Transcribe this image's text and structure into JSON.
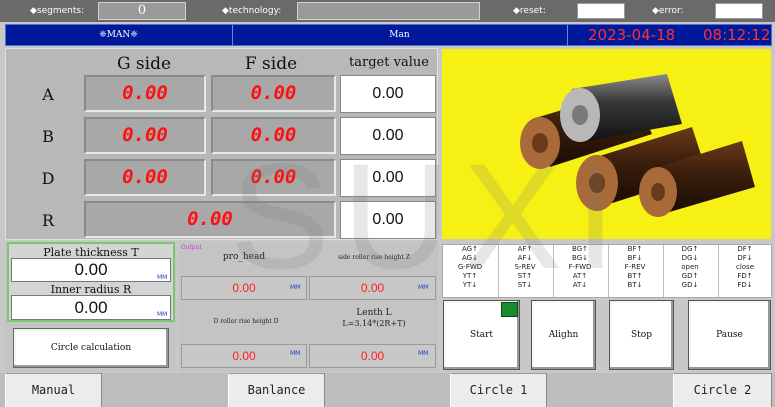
{
  "topbar": {
    "segments_label": "◆segments:",
    "segments_value": "0",
    "technology_label": "◆technology:",
    "technology_value": "",
    "reset_label": "◆reset:",
    "reset_value": "",
    "error_label": "◆error:",
    "error_value": ""
  },
  "status": {
    "mode_label": "❈MAN❈",
    "mode_text": "Man",
    "date": "2023-04-18",
    "time": "08:12:12"
  },
  "table": {
    "col_g": "G side",
    "col_f": "F side",
    "col_target": "target value",
    "rows": [
      {
        "label": "A",
        "g": "0.00",
        "f": "0.00",
        "target": "0.00"
      },
      {
        "label": "B",
        "g": "0.00",
        "f": "0.00",
        "target": "0.00"
      },
      {
        "label": "D",
        "g": "0.00",
        "f": "0.00",
        "target": "0.00"
      }
    ],
    "r_row": {
      "label": "R",
      "value": "0.00",
      "target": "0.00"
    }
  },
  "inputs": {
    "plate_thickness_label": "Plate thickness T",
    "plate_thickness_value": "0.00",
    "plate_unit": "MM",
    "inner_radius_label": "Inner radius R",
    "inner_radius_value": "0.00",
    "inner_unit": "MM",
    "circle_calc_button": "Circle calculation"
  },
  "middle": {
    "output_tag": "Output",
    "pro_head_label": "pro_head",
    "pro_head_value": "0.00",
    "pro_head_unit": "MM",
    "side_roller_label": "side roller rise height Z",
    "side_roller_value": "0.00",
    "side_roller_unit": "MM",
    "d_roller_label": "D roller rise height D",
    "d_roller_value": "0.00",
    "d_roller_unit": "MM",
    "length_label": "Lenth L",
    "length_formula": "L=3.14*(2R+T)",
    "length_value": "0.00",
    "length_unit": "MM"
  },
  "io_grid": {
    "columns": [
      [
        "AG↑",
        "AG↓",
        "G-FWD",
        "YT↑",
        "YT↓"
      ],
      [
        "AF↑",
        "AF↓",
        "S-REV",
        "ST↑",
        "ST↓"
      ],
      [
        "BG↑",
        "BG↓",
        "F-FWD",
        "AT↑",
        "AT↓"
      ],
      [
        "BF↑",
        "BF↓",
        "F-REV",
        "BT↑",
        "BT↓"
      ],
      [
        "DG↑",
        "DG↓",
        "open",
        "GD↑",
        "GD↓"
      ],
      [
        "DF↑",
        "DF↓",
        "close",
        "FD↑",
        "FD↓"
      ]
    ]
  },
  "controls": {
    "start": "Start",
    "alighn": "Alighn",
    "stop": "Stop",
    "pause": "Pause",
    "indicator_color": "#1a8a2a"
  },
  "bottom_nav": {
    "manual": "Manual",
    "banlance": "Banlance",
    "circle1": "Circle 1",
    "circle2": "Circle 2"
  },
  "watermark": "SUXI",
  "colors": {
    "status_bar": "#00189a",
    "led_red": "#ff1010",
    "image_bg": "#f6f014",
    "unit_blue": "#1a3cd0"
  }
}
